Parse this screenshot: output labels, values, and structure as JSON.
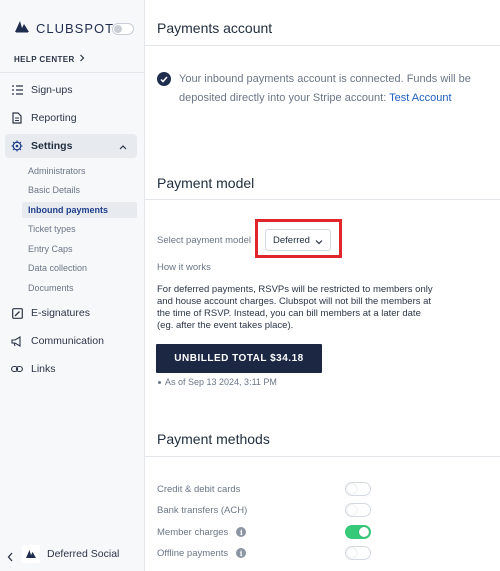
{
  "sidebar": {
    "brand": "CLUBSPOT",
    "help_center": "HELP CENTER",
    "items": [
      {
        "label": "Sign-ups",
        "icon": "list-icon"
      },
      {
        "label": "Reporting",
        "icon": "document-icon"
      },
      {
        "label": "Settings",
        "icon": "gear-icon"
      },
      {
        "label": "E-signatures",
        "icon": "pen-square-icon"
      },
      {
        "label": "Communication",
        "icon": "megaphone-icon"
      },
      {
        "label": "Links",
        "icon": "link-icon"
      }
    ],
    "settings_children": [
      {
        "label": "Administrators"
      },
      {
        "label": "Basic Details"
      },
      {
        "label": "Inbound payments"
      },
      {
        "label": "Ticket types"
      },
      {
        "label": "Entry Caps"
      },
      {
        "label": "Data collection"
      },
      {
        "label": "Documents"
      }
    ],
    "club_name": "Deferred Social"
  },
  "main": {
    "payments_account": {
      "title": "Payments account",
      "connected_text": "Your inbound payments account is connected. Funds will be deposited directly into your Stripe account: ",
      "account_link": "Test Account"
    },
    "payment_model": {
      "title": "Payment model",
      "select_label": "Select payment model",
      "selected_value": "Deferred",
      "how_it_works": "How it works",
      "description": "For deferred payments, RSVPs will be restricted to members only and house account charges. Clubspot will not bill the members at the time of RSVP. Instead, you can bill members at a later date (eg. after the event takes place).",
      "unbilled_button": "UNBILLED TOTAL $34.18",
      "as_of": "As of Sep 13 2024, 3:11 PM"
    },
    "payment_methods": {
      "title": "Payment methods",
      "items": [
        {
          "label": "Credit & debit cards",
          "enabled": false,
          "info": false
        },
        {
          "label": "Bank transfers (ACH)",
          "enabled": false,
          "info": false
        },
        {
          "label": "Member charges",
          "enabled": true,
          "info": true
        },
        {
          "label": "Offline payments",
          "enabled": false,
          "info": true
        }
      ]
    }
  },
  "colors": {
    "accent_dark": "#1c2743",
    "link": "#1f5fbf",
    "toggle_on": "#37c97a",
    "highlight": "#e0262a"
  }
}
